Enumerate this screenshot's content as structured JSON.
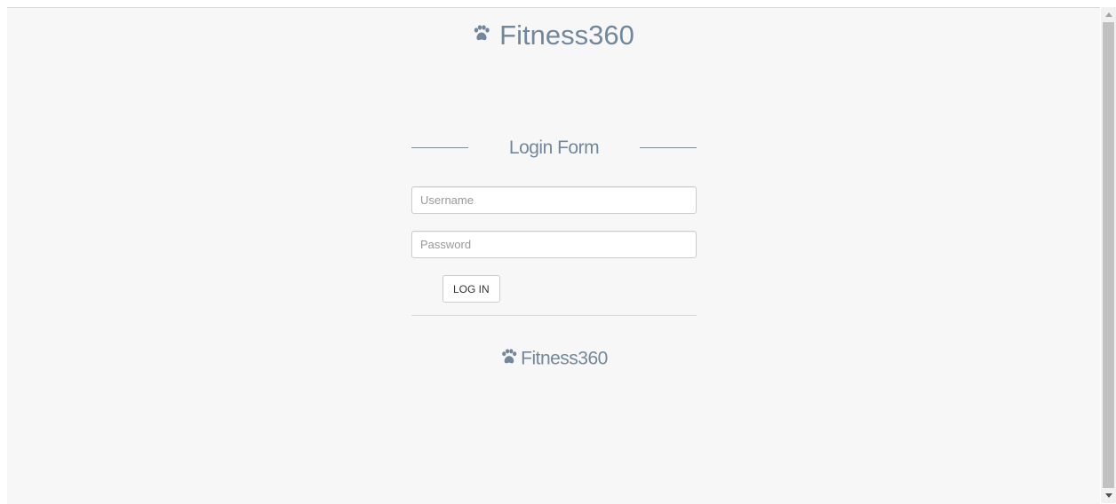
{
  "brand": {
    "top_name": "Fitness360",
    "bottom_name": "Fitness360",
    "icon": "paw-icon",
    "color": "#73879c"
  },
  "login_form": {
    "title": "Login Form",
    "username_placeholder": "Username",
    "username_value": "",
    "password_placeholder": "Password",
    "password_value": "",
    "submit_label": "LOG IN"
  },
  "colors": {
    "page_background": "#f7f7f7",
    "text_muted": "#73879c",
    "border": "#cccccc"
  },
  "scrollbar": {
    "up_icon": "scroll-up-arrow-icon",
    "down_icon": "scroll-down-arrow-icon"
  }
}
